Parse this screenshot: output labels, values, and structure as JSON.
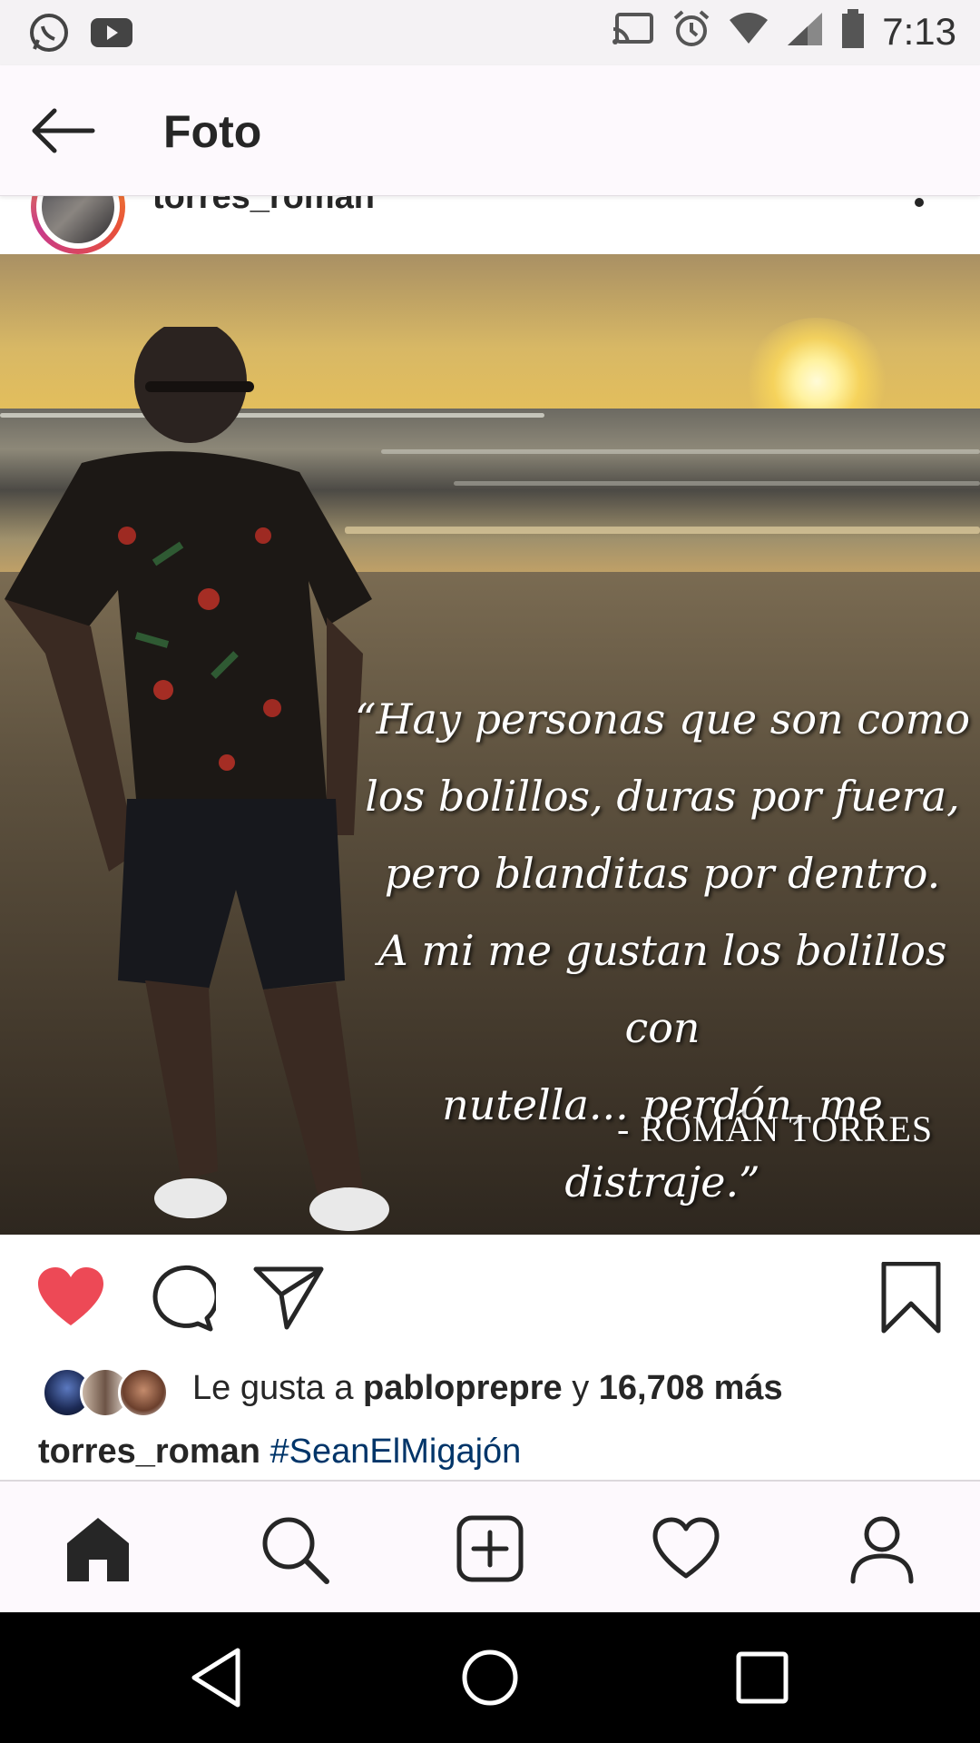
{
  "status_bar": {
    "time": "7:13",
    "left_icons": [
      "whatsapp-icon",
      "youtube-icon"
    ],
    "right_icons": [
      "cast-icon",
      "alarm-icon",
      "wifi-icon",
      "signal-icon",
      "battery-icon"
    ]
  },
  "header": {
    "title": "Foto",
    "back_icon": "arrow-left-icon"
  },
  "post": {
    "username": "torres_roman",
    "more_icon": "more-options-icon",
    "photo": {
      "quote_lines": [
        "“Hay personas que son como",
        "los bolillos, duras por fuera,",
        "pero blanditas por dentro.",
        "A mi me gustan los bolillos con",
        "nutella... perdón, me distraje.”"
      ],
      "quote_author": "- ROMÁN TORRES"
    },
    "actions": {
      "like_icon": "heart-filled-icon",
      "comment_icon": "comment-icon",
      "share_icon": "direct-send-icon",
      "save_icon": "bookmark-icon"
    },
    "likes": {
      "prefix": "Le gusta a",
      "user": "pabloprepre",
      "connector": "y",
      "count": "16,708 más"
    },
    "caption": {
      "user": "torres_roman",
      "hashtag": "#SeanElMigajón"
    }
  },
  "bottom_nav": [
    "home-icon",
    "search-icon",
    "new-post-icon",
    "activity-heart-icon",
    "profile-icon"
  ],
  "system_nav": [
    "back-triangle-icon",
    "home-circle-icon",
    "recents-square-icon"
  ],
  "colors": {
    "like_red": "#ed4956",
    "hashtag_blue": "#003569",
    "text": "#262626"
  }
}
